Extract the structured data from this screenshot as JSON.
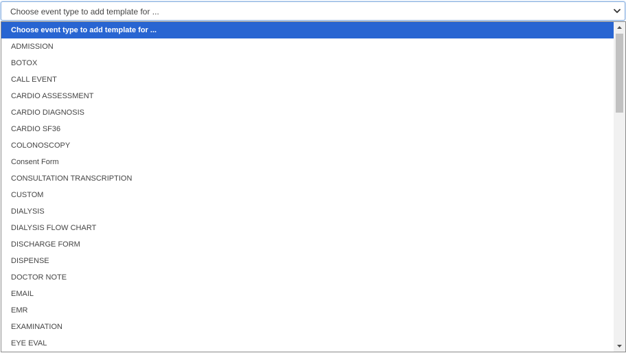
{
  "select": {
    "value": "Choose event type to add template for ..."
  },
  "dropdown": {
    "options": [
      {
        "label": "Choose event type to add template for ...",
        "selected": true
      },
      {
        "label": "ADMISSION"
      },
      {
        "label": "BOTOX"
      },
      {
        "label": "CALL EVENT"
      },
      {
        "label": "CARDIO ASSESSMENT"
      },
      {
        "label": "CARDIO DIAGNOSIS"
      },
      {
        "label": "CARDIO SF36"
      },
      {
        "label": "COLONOSCOPY"
      },
      {
        "label": "Consent Form"
      },
      {
        "label": "CONSULTATION TRANSCRIPTION"
      },
      {
        "label": "CUSTOM"
      },
      {
        "label": "DIALYSIS"
      },
      {
        "label": "DIALYSIS FLOW CHART"
      },
      {
        "label": "DISCHARGE FORM"
      },
      {
        "label": "DISPENSE"
      },
      {
        "label": "DOCTOR NOTE"
      },
      {
        "label": "EMAIL"
      },
      {
        "label": "EMR"
      },
      {
        "label": "EXAMINATION"
      },
      {
        "label": "EYE EVAL"
      }
    ]
  },
  "icons": {
    "select_arrow": "chevron-down-icon",
    "scroll_up": "scroll-up-arrow-icon",
    "scroll_down": "scroll-down-arrow-icon"
  },
  "colors": {
    "selected_bg": "#2865d2",
    "selected_text": "#ffffff",
    "option_text": "#444444",
    "focus_border": "#8fb3e0"
  }
}
